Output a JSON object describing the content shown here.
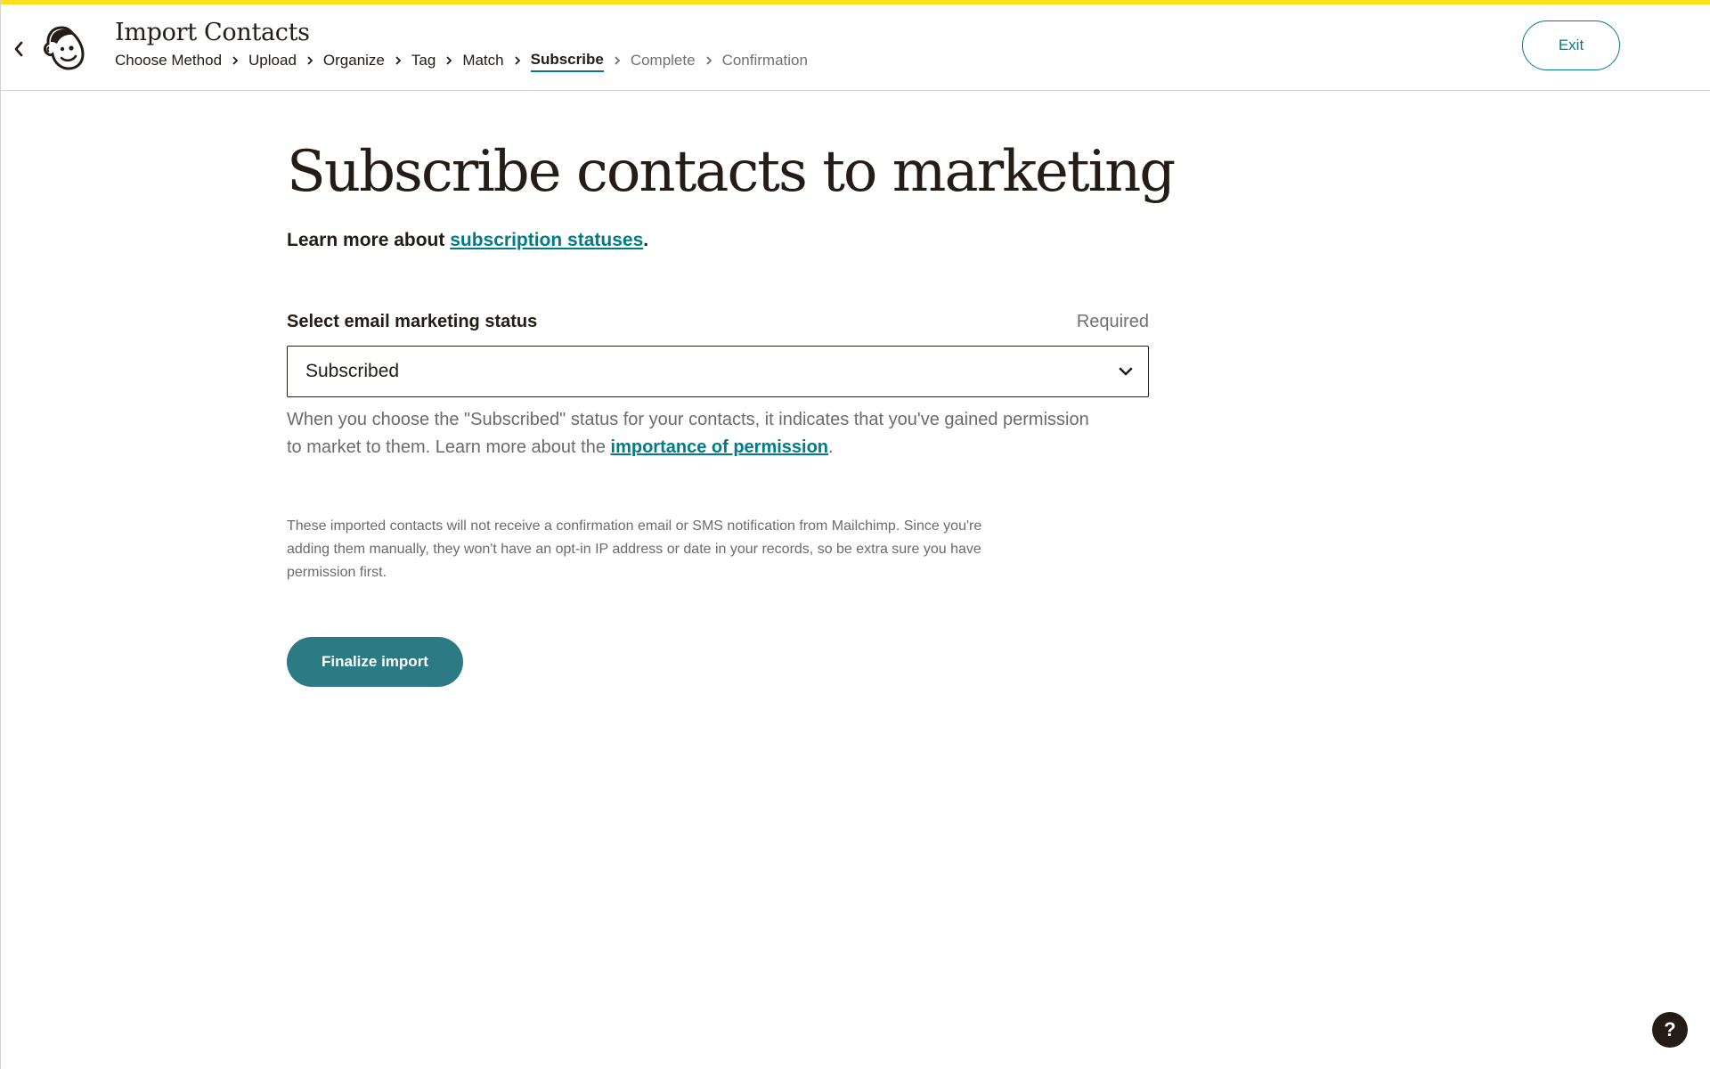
{
  "app": {
    "accent_color": "#ffe01b",
    "link_color": "#007c89",
    "primary_button_color": "#2c7a83"
  },
  "header": {
    "title": "Import Contacts",
    "back_icon": "chevron-left-icon",
    "logo_icon": "mailchimp-freddie-logo-icon",
    "breadcrumbs": [
      {
        "label": "Choose Method",
        "state": "done"
      },
      {
        "label": "Upload",
        "state": "done"
      },
      {
        "label": "Organize",
        "state": "done"
      },
      {
        "label": "Tag",
        "state": "done"
      },
      {
        "label": "Match",
        "state": "done"
      },
      {
        "label": "Subscribe",
        "state": "current"
      },
      {
        "label": "Complete",
        "state": "upcoming"
      },
      {
        "label": "Confirmation",
        "state": "upcoming"
      }
    ],
    "exit_label": "Exit"
  },
  "main": {
    "heading": "Subscribe contacts to marketing",
    "learn_prefix": "Learn more about ",
    "learn_link": "subscription statuses",
    "learn_suffix": ".",
    "field_label": "Select email marketing status",
    "required_label": "Required",
    "select_value": "Subscribed",
    "select_icon": "chevron-down-icon",
    "help_text": "When you choose the \"Subscribed\" status for your contacts, it indicates that you've gained permission to market to them. Learn more about the ",
    "help_link": "importance of permission",
    "help_suffix": ".",
    "note_text": "These imported contacts will not receive a confirmation email or SMS notification from Mailchimp. Since you're adding them manually, they won't have an opt-in IP address or date in your records, so be extra sure you have permission first.",
    "finalize_label": "Finalize import"
  },
  "help_fab": {
    "label": "?",
    "icon": "question-icon"
  }
}
